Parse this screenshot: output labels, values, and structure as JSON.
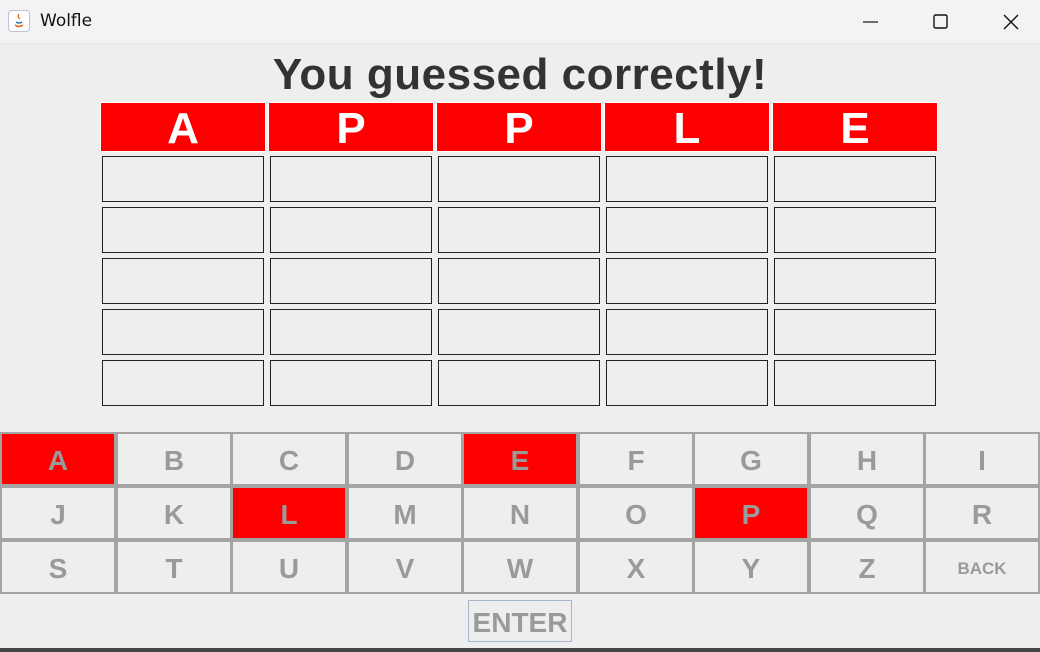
{
  "window": {
    "title": "Wolfle",
    "controls": [
      "minimize-icon",
      "maximize-icon",
      "close-icon"
    ]
  },
  "message": "You guessed correctly!",
  "answer": [
    "A",
    "P",
    "P",
    "L",
    "E"
  ],
  "guess_rows": [
    [
      "",
      "",
      "",
      "",
      ""
    ],
    [
      "",
      "",
      "",
      "",
      ""
    ],
    [
      "",
      "",
      "",
      "",
      ""
    ],
    [
      "",
      "",
      "",
      "",
      ""
    ],
    [
      "",
      "",
      "",
      "",
      ""
    ]
  ],
  "keyboard": {
    "rows": [
      [
        {
          "label": "A",
          "state": "hit"
        },
        {
          "label": "B",
          "state": "none"
        },
        {
          "label": "C",
          "state": "none"
        },
        {
          "label": "D",
          "state": "none"
        },
        {
          "label": "E",
          "state": "hit"
        },
        {
          "label": "F",
          "state": "none"
        },
        {
          "label": "G",
          "state": "none"
        },
        {
          "label": "H",
          "state": "none"
        },
        {
          "label": "I",
          "state": "none"
        }
      ],
      [
        {
          "label": "J",
          "state": "none"
        },
        {
          "label": "K",
          "state": "none"
        },
        {
          "label": "L",
          "state": "hit"
        },
        {
          "label": "M",
          "state": "none"
        },
        {
          "label": "N",
          "state": "none"
        },
        {
          "label": "O",
          "state": "none"
        },
        {
          "label": "P",
          "state": "hit"
        },
        {
          "label": "Q",
          "state": "none"
        },
        {
          "label": "R",
          "state": "none"
        }
      ],
      [
        {
          "label": "S",
          "state": "none"
        },
        {
          "label": "T",
          "state": "none"
        },
        {
          "label": "U",
          "state": "none"
        },
        {
          "label": "V",
          "state": "none"
        },
        {
          "label": "W",
          "state": "none"
        },
        {
          "label": "X",
          "state": "none"
        },
        {
          "label": "Y",
          "state": "none"
        },
        {
          "label": "Z",
          "state": "none"
        },
        {
          "label": "BACK",
          "state": "none"
        }
      ]
    ],
    "enter_label": "ENTER"
  },
  "colors": {
    "hit": "#ff0000",
    "background": "#eeeeee",
    "key_text": "#9a9a9a"
  }
}
